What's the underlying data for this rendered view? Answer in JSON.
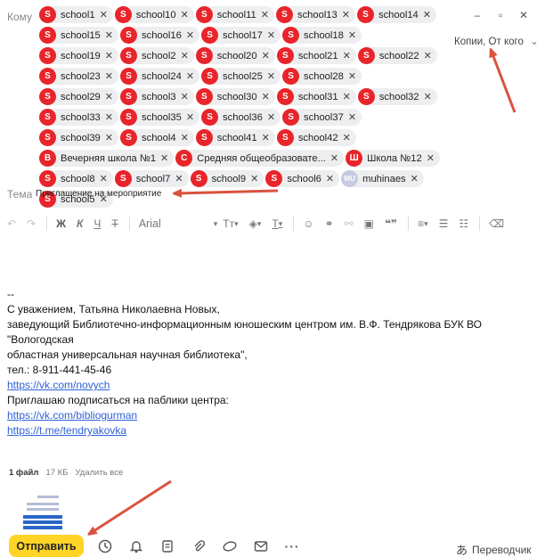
{
  "header": {
    "to_label": "Кому",
    "cc_label": "Копии, От кого",
    "minimize_icon": "minimize-icon",
    "restore_icon": "restore-icon",
    "close_icon": "close-icon"
  },
  "recipients": [
    {
      "initial": "S",
      "name": "school1"
    },
    {
      "initial": "S",
      "name": "school10"
    },
    {
      "initial": "S",
      "name": "school11"
    },
    {
      "initial": "S",
      "name": "school13"
    },
    {
      "initial": "S",
      "name": "school14"
    },
    {
      "initial": "S",
      "name": "school15"
    },
    {
      "initial": "S",
      "name": "school16"
    },
    {
      "initial": "S",
      "name": "school17"
    },
    {
      "initial": "S",
      "name": "school18"
    },
    {
      "initial": "S",
      "name": "school19"
    },
    {
      "initial": "S",
      "name": "school2"
    },
    {
      "initial": "S",
      "name": "school20"
    },
    {
      "initial": "S",
      "name": "school21"
    },
    {
      "initial": "S",
      "name": "school22"
    },
    {
      "initial": "S",
      "name": "school23"
    },
    {
      "initial": "S",
      "name": "school24"
    },
    {
      "initial": "S",
      "name": "school25"
    },
    {
      "initial": "S",
      "name": "school28"
    },
    {
      "initial": "S",
      "name": "school29"
    },
    {
      "initial": "S",
      "name": "school3"
    },
    {
      "initial": "S",
      "name": "school30"
    },
    {
      "initial": "S",
      "name": "school31"
    },
    {
      "initial": "S",
      "name": "school32"
    },
    {
      "initial": "S",
      "name": "school33"
    },
    {
      "initial": "S",
      "name": "school35"
    },
    {
      "initial": "S",
      "name": "school36"
    },
    {
      "initial": "S",
      "name": "school37"
    },
    {
      "initial": "S",
      "name": "school39"
    },
    {
      "initial": "S",
      "name": "school4"
    },
    {
      "initial": "S",
      "name": "school41"
    },
    {
      "initial": "S",
      "name": "school42"
    },
    {
      "initial": "В",
      "name": "Вечерняя школа №1"
    },
    {
      "initial": "С",
      "name": "Средняя общеобразовате..."
    },
    {
      "initial": "Ш",
      "name": "Школа №12"
    },
    {
      "initial": "S",
      "name": "school8"
    },
    {
      "initial": "S",
      "name": "school7"
    },
    {
      "initial": "S",
      "name": "school9"
    },
    {
      "initial": "S",
      "name": "school6"
    },
    {
      "initial": "MU",
      "name": "muhinaes"
    },
    {
      "initial": "S",
      "name": "school5"
    }
  ],
  "subject": {
    "label": "Тема",
    "value": "Приглашение на мероприятие"
  },
  "toolbar": {
    "bold": "Ж",
    "italic": "К",
    "underline": "Ч",
    "strike": "Т",
    "font": "Arial",
    "text_size": "Тт"
  },
  "body": {
    "separator": "--",
    "line1": "С уважением, Татьяна Николаевна Новых,",
    "line2": "заведующий Библиотечно-информационным юношеским центром им. В.Ф. Тендрякова БУК ВО \"Вологодская",
    "line3": "областная универсальная научная библиотека\",",
    "line4": "тел.: 8-911-441-45-46",
    "link1": "https://vk.com/novych",
    "line5": "Приглашаю подписаться на паблики центра:",
    "link2": "https://vk.com/bibliogurman",
    "link3": "https://t.me/tendryakovka"
  },
  "attachments": {
    "count": "1 файл",
    "size": "17 КБ",
    "delete_all": "Удалить все"
  },
  "footer": {
    "send": "Отправить",
    "translator": "Переводчик"
  },
  "colors": {
    "avatar": "#e8252a",
    "send_button": "#ffd426",
    "link": "#2f61d8",
    "annotation_arrow": "#d9533f"
  }
}
